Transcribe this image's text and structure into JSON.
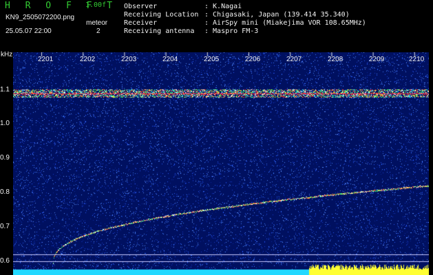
{
  "header": {
    "brand": "H R O F F T",
    "version": "1.00f",
    "filename": "KN9_2505072200.png",
    "timestamp": "25.05.07 22:00",
    "meteor_label": "meteor",
    "meteor_count": "2",
    "info": [
      {
        "key": "Observer",
        "value": ": K.Nagai"
      },
      {
        "key": "Receiving Location",
        "value": ": Chigasaki, Japan (139.414 35.340)"
      },
      {
        "key": "Receiver",
        "value": ": AirSpy mini (Miakejima VOR 108.65MHz)"
      },
      {
        "key": "Receiving antenna",
        "value": ": Maspro FM-3"
      }
    ]
  },
  "spectrogram": {
    "y_unit": "kHz",
    "y_ticks": [
      "1.1",
      "1.0",
      "0.9",
      "0.8",
      "0.7",
      "0.6"
    ],
    "x_ticks": [
      "2201",
      "2202",
      "2203",
      "2204",
      "2205",
      "2206",
      "2207",
      "2208",
      "2209",
      "2210"
    ],
    "colors": {
      "background": "#001060",
      "noise": "#2a5cff",
      "carrier": "#ff3030",
      "level_cyan": "#22d8ff",
      "level_yellow": "#ffff33"
    }
  }
}
